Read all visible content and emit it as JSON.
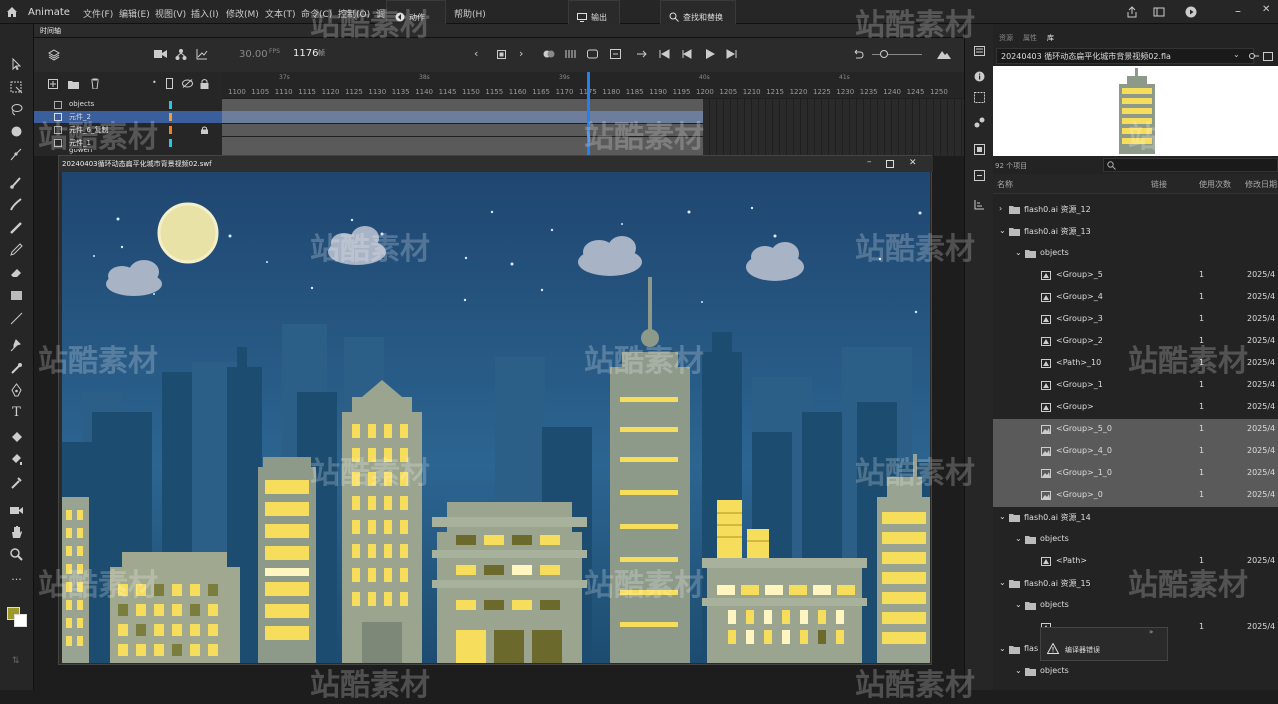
{
  "app": {
    "name": "Animate"
  },
  "menu": [
    "文件(F)",
    "编辑(E)",
    "视图(V)",
    "插入(I)",
    "修改(M)",
    "文本(T)",
    "命令(C)",
    "控制(O)",
    "调试",
    "帮助(H)"
  ],
  "top_buttons": {
    "actions": "动作",
    "output": "输出",
    "find_replace": "查找和替换"
  },
  "timeline": {
    "tab": "时间轴",
    "fps": "30.00",
    "fps_unit": "FPS",
    "frame": "1176",
    "frame_unit": "帧",
    "ruler": [
      "1100",
      "1105",
      "1110",
      "1115",
      "1120",
      "1125",
      "1130",
      "1135",
      "1140",
      "1145",
      "1150",
      "1155",
      "1160",
      "1165",
      "1170",
      "1175",
      "1180",
      "1185",
      "1190",
      "1195",
      "1200",
      "1205",
      "1210",
      "1215",
      "1220",
      "1225",
      "1230",
      "1235",
      "1240",
      "1245",
      "1250"
    ],
    "seconds": [
      "37s",
      "38s",
      "39s",
      "40s",
      "41s"
    ],
    "layers": [
      {
        "name": "objects",
        "color": "#27c8e0"
      },
      {
        "name": "元件_2",
        "color": "#f0a030"
      },
      {
        "name": "元件_6_复制",
        "color": "#f08020"
      },
      {
        "name": "元件_1",
        "color": "#27c8e0"
      },
      {
        "name": "gowen",
        "color": "#f0a030"
      }
    ],
    "scene_label": "2024"
  },
  "swf_window": {
    "title": "20240403循环动态扁平化城市背景视频02.swf"
  },
  "library": {
    "tabs": [
      "资源",
      "属性",
      "库"
    ],
    "file": "20240403 循环动态扁平化城市背景视频02.fla",
    "count": "92 个项目",
    "columns": {
      "name": "名称",
      "link": "链接",
      "usage": "使用次数",
      "date": "修改日期"
    },
    "items": [
      {
        "name": "flash0.ai 资源_12",
        "indent": 0,
        "type": "folder",
        "expanded": false,
        "usage": "",
        "date": "",
        "selected": false
      },
      {
        "name": "flash0.ai 资源_13",
        "indent": 0,
        "type": "folder",
        "expanded": true,
        "usage": "",
        "date": "",
        "selected": false
      },
      {
        "name": "objects",
        "indent": 1,
        "type": "folder",
        "expanded": true,
        "usage": "",
        "date": "",
        "selected": false
      },
      {
        "name": "<Group>_5",
        "indent": 2,
        "type": "graphic",
        "usage": "1",
        "date": "2025/4",
        "selected": false
      },
      {
        "name": "<Group>_4",
        "indent": 2,
        "type": "graphic",
        "usage": "1",
        "date": "2025/4",
        "selected": false
      },
      {
        "name": "<Group>_3",
        "indent": 2,
        "type": "graphic",
        "usage": "1",
        "date": "2025/4",
        "selected": false
      },
      {
        "name": "<Group>_2",
        "indent": 2,
        "type": "graphic",
        "usage": "1",
        "date": "2025/4",
        "selected": false
      },
      {
        "name": "<Path>_10",
        "indent": 2,
        "type": "graphic",
        "usage": "1",
        "date": "2025/4",
        "selected": false
      },
      {
        "name": "<Group>_1",
        "indent": 2,
        "type": "graphic",
        "usage": "1",
        "date": "2025/4",
        "selected": false
      },
      {
        "name": "<Group>",
        "indent": 2,
        "type": "graphic",
        "usage": "1",
        "date": "2025/4",
        "selected": false
      },
      {
        "name": "<Group>_5_0",
        "indent": 2,
        "type": "bitmap",
        "usage": "1",
        "date": "2025/4",
        "selected": true
      },
      {
        "name": "<Group>_4_0",
        "indent": 2,
        "type": "bitmap",
        "usage": "1",
        "date": "2025/4",
        "selected": true
      },
      {
        "name": "<Group>_1_0",
        "indent": 2,
        "type": "bitmap",
        "usage": "1",
        "date": "2025/4",
        "selected": true
      },
      {
        "name": "<Group>_0",
        "indent": 2,
        "type": "bitmap",
        "usage": "1",
        "date": "2025/4",
        "selected": true
      },
      {
        "name": "flash0.ai 资源_14",
        "indent": 0,
        "type": "folder",
        "expanded": true,
        "usage": "",
        "date": "",
        "selected": false
      },
      {
        "name": "objects",
        "indent": 1,
        "type": "folder",
        "expanded": true,
        "usage": "",
        "date": "",
        "selected": false
      },
      {
        "name": "<Path>",
        "indent": 2,
        "type": "graphic",
        "usage": "1",
        "date": "2025/4",
        "selected": false
      },
      {
        "name": "flash0.ai 资源_15",
        "indent": 0,
        "type": "folder",
        "expanded": true,
        "usage": "",
        "date": "",
        "selected": false
      },
      {
        "name": "objects",
        "indent": 1,
        "type": "folder",
        "expanded": true,
        "usage": "",
        "date": "",
        "selected": false
      },
      {
        "name": "",
        "indent": 2,
        "type": "graphic",
        "usage": "1",
        "date": "2025/4",
        "selected": false
      },
      {
        "name": "flas",
        "indent": 0,
        "type": "folder",
        "expanded": true,
        "usage": "",
        "date": "",
        "selected": false
      },
      {
        "name": "objects",
        "indent": 1,
        "type": "folder",
        "expanded": true,
        "usage": "",
        "date": "",
        "selected": false
      }
    ]
  },
  "compiler_errors": {
    "label": "编译器错误"
  },
  "watermark": "站酷素材",
  "colors": {
    "sky_top": "#1f4670",
    "sky_bottom": "#2c6591",
    "window_yellow": "#f6de5c",
    "building_gray": "#8d9a8a",
    "accent": "#2680eb"
  }
}
